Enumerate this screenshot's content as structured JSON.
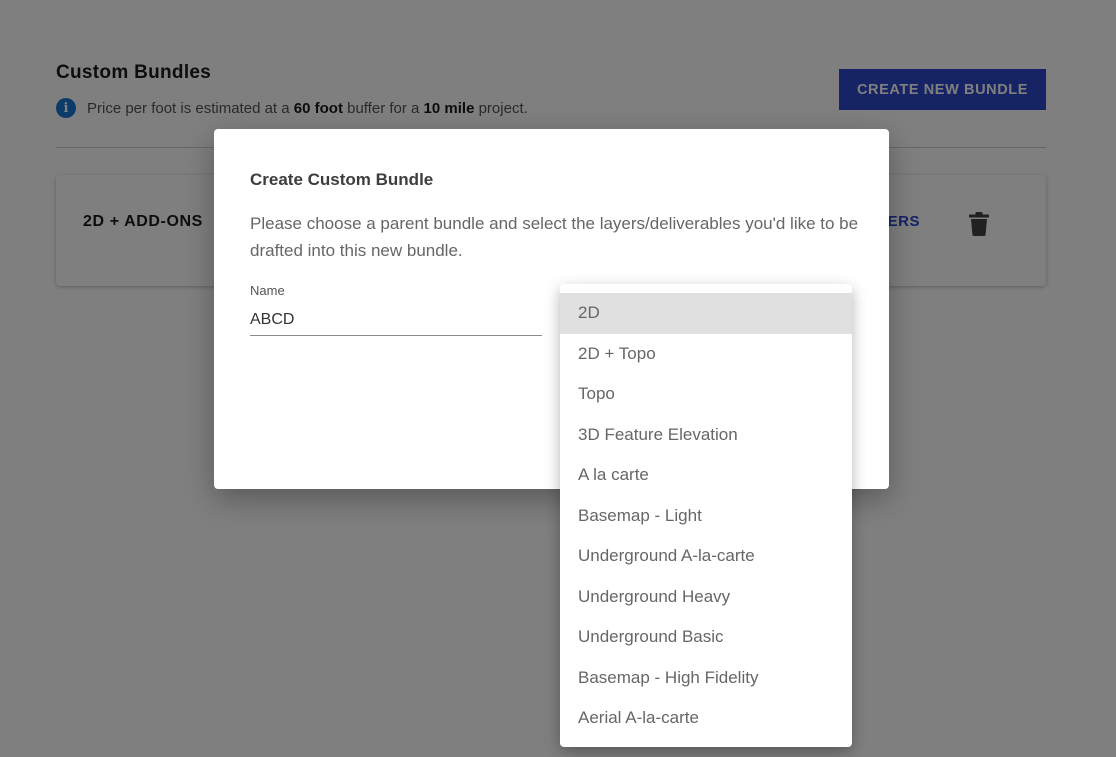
{
  "page": {
    "title": "Custom Bundles",
    "info": {
      "prefix": "Price per foot is estimated at a ",
      "buffer": "60 foot",
      "middle": " buffer for a ",
      "distance": "10 mile",
      "suffix": " project."
    },
    "create_button": "CREATE NEW BUNDLE",
    "bundle": {
      "name": "2D + ADD-ONS",
      "layers_link": "ERS"
    }
  },
  "dialog": {
    "title": "Create Custom Bundle",
    "description": "Please choose a parent bundle and select the layers/deliverables you'd like to be drafted into this new bundle.",
    "name_label": "Name",
    "name_value": "ABCD"
  },
  "dropdown": {
    "selected": "2D",
    "options": [
      "2D",
      "2D + Topo",
      "Topo",
      "3D Feature Elevation",
      "A la carte",
      "Basemap - Light",
      "Underground A-la-carte",
      "Underground Heavy",
      "Underground Basic",
      "Basemap - High Fidelity",
      "Aerial A-la-carte"
    ]
  },
  "colors": {
    "accent": "#2c46c8",
    "info_icon": "#1976d2",
    "backdrop": "rgba(0,0,0,0.5)"
  }
}
